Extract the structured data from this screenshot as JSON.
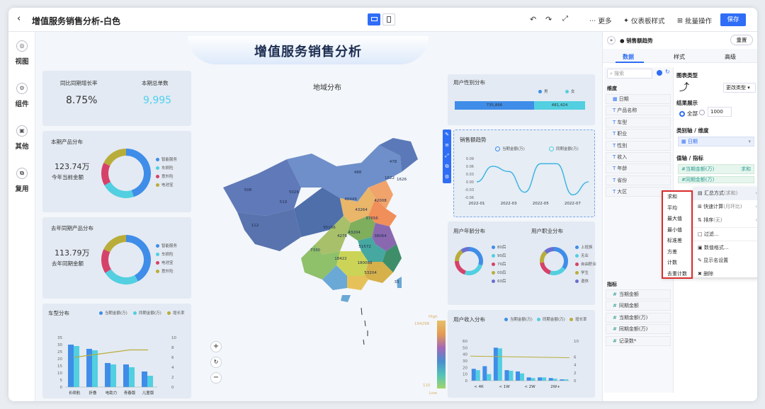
{
  "toolbar": {
    "title": "增值服务销售分析-白色",
    "more": "更多",
    "dashboard_style": "仪表板样式",
    "batch": "批量操作",
    "save": "保存"
  },
  "sidebar": {
    "items": [
      {
        "label": "视图",
        "icon": "view-icon"
      },
      {
        "label": "组件",
        "icon": "component-icon"
      },
      {
        "label": "其他",
        "icon": "other-icon"
      },
      {
        "label": "复用",
        "icon": "reuse-icon"
      }
    ]
  },
  "canvas": {
    "banner": "增值服务销售分析",
    "map_title": "地域分布"
  },
  "kpi": {
    "l1": "同比同期增长率",
    "v1": "8.75%",
    "l2": "本期总单数",
    "v2": "9,995"
  },
  "donut1": {
    "title": "本期产品分布",
    "value": "123.74万",
    "sub": "今年当前金额",
    "legend": [
      "智能服务",
      "车损险",
      "意外险",
      "电池宝"
    ],
    "colors": [
      "#3f8de8",
      "#52cfe0",
      "#d6416a",
      "#b9ad3a"
    ]
  },
  "donut2": {
    "title": "去年同期产品分布",
    "value": "113.79万",
    "sub": "去年同期金额",
    "legend": [
      "智能服务",
      "车损险",
      "电池宝",
      "意外险"
    ],
    "colors": [
      "#3f8de8",
      "#52cfe0",
      "#d6416a",
      "#b9ad3a"
    ]
  },
  "car": {
    "title": "车型分布",
    "legend": [
      "当期金额(万)",
      "同期金额(万)",
      "增长率"
    ],
    "categories": [
      "长续航",
      "折叠",
      "电助力",
      "青春版",
      "儿童版"
    ],
    "yl": [
      "35",
      "30",
      "25",
      "20",
      "15",
      "10",
      "5",
      "0"
    ],
    "yr": [
      "10",
      "8",
      "6",
      "4",
      "2",
      "0"
    ]
  },
  "gender": {
    "title": "用户性别分布",
    "legend": [
      "男",
      "女"
    ],
    "v1": "735,866",
    "v2": "481,424"
  },
  "trend": {
    "title": "销售额趋势",
    "legend": [
      "当期金额(万)",
      "同期金额(万)"
    ],
    "y": [
      "0.09",
      "0.06",
      "0.03",
      "0.00",
      "-0.03",
      "-0.06"
    ],
    "x": [
      "2022-01",
      "2022-03",
      "2022-05",
      "2022-07"
    ]
  },
  "age": {
    "title": "用户年龄分布",
    "legend": [
      "80后",
      "90后",
      "70后",
      "00后",
      "60后"
    ]
  },
  "job": {
    "title": "用户职业分布",
    "legend": [
      "上班族",
      "无业",
      "自由职业",
      "学生",
      "退休"
    ]
  },
  "income": {
    "title": "用户收入分布",
    "legend": [
      "当期金额(万)",
      "同期金额(万)",
      "增长率"
    ],
    "x": [
      "< 4K",
      "< 1W",
      "< 2W",
      "2W+"
    ],
    "yl": [
      "60",
      "50",
      "40",
      "30",
      "20",
      "10",
      "0"
    ],
    "yr": [
      "10",
      "6",
      "4",
      "2",
      "0"
    ]
  },
  "scale": {
    "high": "High",
    "hv": "194298",
    "low": "Low",
    "lv": "110"
  },
  "map": {
    "labels": [
      "478",
      "488",
      "1622",
      "1626",
      "508",
      "5026",
      "519",
      "48449",
      "42008",
      "43264",
      "37656",
      "112",
      "95166",
      "4278",
      "43204",
      "38064",
      "51572",
      "7330",
      "18422",
      "180068",
      "53204",
      "33"
    ]
  },
  "panel": {
    "title": "销售额趋势",
    "reset": "重置",
    "tabs": [
      "数据",
      "样式",
      "高级"
    ],
    "search": "搜索",
    "dim_header": "维度",
    "dims": [
      "日期",
      "产品名称",
      "车型",
      "职业",
      "性别",
      "收入",
      "年龄",
      "省份",
      "大区"
    ],
    "measure_header": "指标",
    "measures": [
      "当期金额",
      "同期金额",
      "当期金额(万)",
      "同期金额(万)",
      "记录数*"
    ],
    "chart_type_label": "图表类型",
    "change_type": "更改类型",
    "result_label": "结果展示",
    "all": "全部",
    "count": "1000",
    "cat_label": "类别轴 / 维度",
    "cat_field": "日期",
    "val_label": "值轴 / 指标",
    "val_field1": "当期金额(万)",
    "val_agg": "求和",
    "val_field2": "同期金额(万)"
  },
  "agg_menu": [
    "求和",
    "平均",
    "最大值",
    "最小值",
    "标准差",
    "方差",
    "计数",
    "去重计数"
  ],
  "ctx_menu": [
    {
      "label": "汇总方式",
      "sub": "(求和)"
    },
    {
      "label": "快速计算",
      "sub": "(月环比)"
    },
    {
      "label": "排序",
      "sub": "(无)"
    },
    {
      "label": "过滤...",
      "sub": ""
    },
    {
      "label": "数值格式...",
      "sub": ""
    },
    {
      "label": "显示名设置",
      "sub": ""
    },
    {
      "label": "删除",
      "sub": ""
    }
  ],
  "chart_data": [
    {
      "type": "bar",
      "title": "车型分布",
      "categories": [
        "长续航",
        "折叠",
        "电助力",
        "青春版",
        "儿童版"
      ],
      "series": [
        {
          "name": "当期金额(万)",
          "values": [
            30,
            27,
            17,
            16,
            11
          ]
        },
        {
          "name": "同期金额(万)",
          "values": [
            29,
            26,
            16,
            14,
            8
          ]
        },
        {
          "name": "增长率",
          "values": [
            6,
            6.5,
            7,
            7.5,
            7.5
          ]
        }
      ]
    },
    {
      "type": "line",
      "title": "销售额趋势",
      "x": [
        "2022-01",
        "2022-02",
        "2022-03",
        "2022-04",
        "2022-05",
        "2022-06",
        "2022-07",
        "2022-08"
      ],
      "series": [
        {
          "name": "当期金额(万)",
          "values": [
            0.0,
            0.06,
            0.04,
            -0.04,
            0.07,
            0.07,
            -0.05,
            0.0
          ]
        },
        {
          "name": "同期金额(万)",
          "values": [
            0.0,
            0.06,
            0.04,
            -0.04,
            0.07,
            0.07,
            -0.05,
            0.0
          ]
        }
      ]
    },
    {
      "type": "bar",
      "title": "用户收入分布",
      "categories": [
        "< 4K",
        "< 1W",
        "< 2W",
        "2W+"
      ],
      "series": [
        {
          "name": "当期金额(万)",
          "values": [
            18,
            22,
            50,
            16,
            14,
            5,
            5,
            4,
            2
          ]
        },
        {
          "name": "同期金额(万)",
          "values": [
            16,
            10,
            49,
            15,
            11,
            4,
            5,
            3,
            2
          ]
        }
      ]
    }
  ]
}
